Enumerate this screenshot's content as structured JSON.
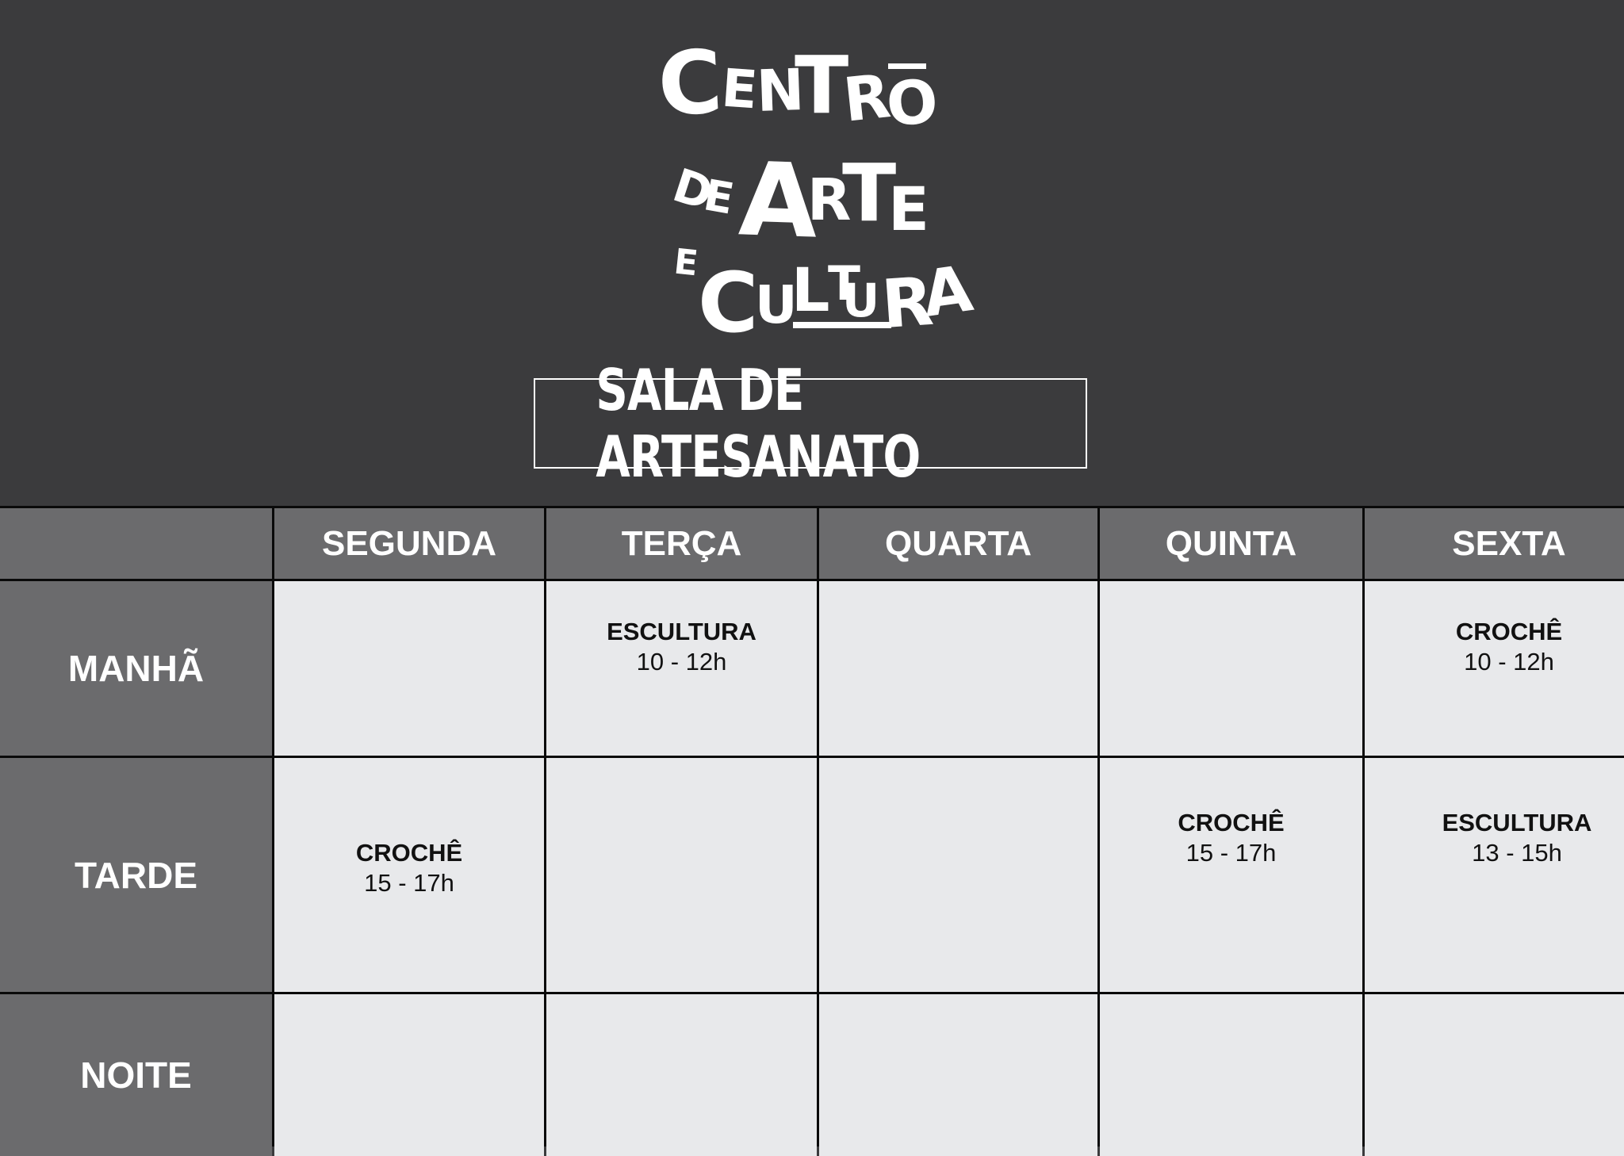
{
  "logo": {
    "line1": [
      "C",
      "E",
      "N",
      "T",
      "R",
      "O"
    ],
    "line2": [
      "D",
      "E",
      "A",
      "R",
      "T",
      "E"
    ],
    "line3": [
      "E",
      "C",
      "U",
      "L",
      "T",
      "U",
      "R",
      "A"
    ]
  },
  "title": "SALA DE ARTESANATO",
  "days": [
    "SEGUNDA",
    "TERÇA",
    "QUARTA",
    "QUINTA",
    "SEXTA"
  ],
  "periods": [
    "MANHÃ",
    "TARDE",
    "NOITE"
  ],
  "schedule": {
    "manha": {
      "terca": {
        "activity": "ESCULTURA",
        "time": "10 - 12h"
      },
      "sexta": {
        "activity": "CROCHÊ",
        "time": "10 - 12h"
      }
    },
    "tarde": {
      "segunda": {
        "activity": "CROCHÊ",
        "time": "15 - 17h"
      },
      "quinta": {
        "activity": "CROCHÊ",
        "time": "15 - 17h"
      },
      "sexta": {
        "activity": "ESCULTURA",
        "time": "13 - 15h"
      }
    }
  },
  "colors": {
    "background": "#3b3b3d",
    "header_cell": "#6b6b6d",
    "body_cell": "#e8e9eb",
    "grid_line": "#0a0a0a"
  }
}
